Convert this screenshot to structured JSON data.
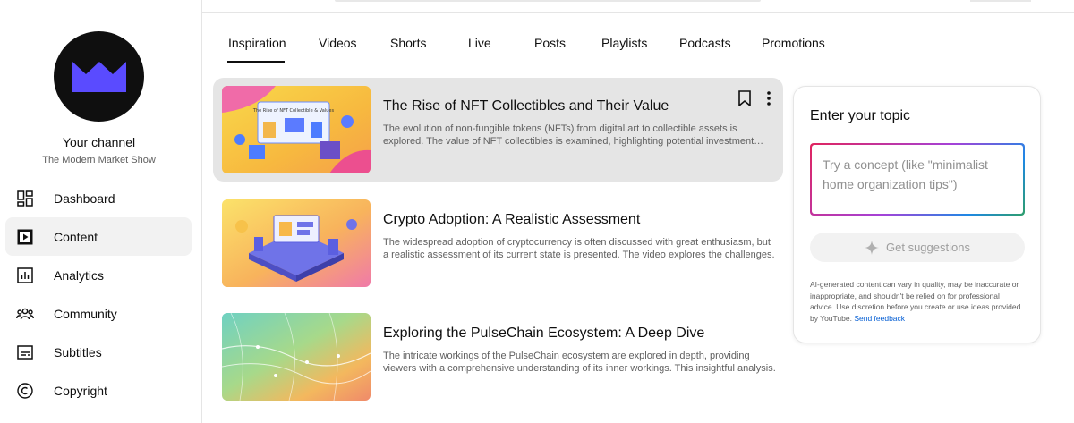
{
  "sidebar": {
    "channel_title": "Your channel",
    "channel_name": "The Modern Market Show",
    "items": [
      {
        "label": "Dashboard",
        "icon": "dashboard-icon"
      },
      {
        "label": "Content",
        "icon": "content-icon",
        "active": true
      },
      {
        "label": "Analytics",
        "icon": "analytics-icon"
      },
      {
        "label": "Community",
        "icon": "community-icon"
      },
      {
        "label": "Subtitles",
        "icon": "subtitles-icon"
      },
      {
        "label": "Copyright",
        "icon": "copyright-icon"
      }
    ]
  },
  "tabs": [
    {
      "label": "Inspiration",
      "active": true
    },
    {
      "label": "Videos"
    },
    {
      "label": "Shorts"
    },
    {
      "label": "Live"
    },
    {
      "label": "Posts"
    },
    {
      "label": "Playlists"
    },
    {
      "label": "Podcasts"
    },
    {
      "label": "Promotions"
    }
  ],
  "videos": [
    {
      "title": "The Rise of NFT Collectibles and Their Value",
      "description": "The evolution of non-fungible tokens (NFTs) from digital art to collectible assets is explored. The value of NFT collectibles is examined, highlighting potential investment opportunities.",
      "thumbnail_text": "The Rise of NFT Collectible & Values",
      "icon": "nft-thumbnail"
    },
    {
      "title": "Crypto Adoption: A Realistic Assessment",
      "description": "The widespread adoption of cryptocurrency is often discussed with great enthusiasm, but a realistic assessment of its current state is presented. The video explores the challenges.",
      "icon": "crypto-thumbnail"
    },
    {
      "title": "Exploring the PulseChain Ecosystem: A Deep Dive",
      "description": "The intricate workings of the PulseChain ecosystem are explored in depth, providing viewers with a comprehensive understanding of its inner workings. This insightful analysis.",
      "icon": "pulsechain-thumbnail"
    }
  ],
  "panel": {
    "title": "Enter your topic",
    "placeholder": "Try a concept (like \"minimalist home organization tips\")",
    "button_label": "Get suggestions",
    "disclaimer": "AI-generated content can vary in quality, may be inaccurate or inappropriate, and shouldn't be relied on for professional advice. Use discretion before you create or use ideas provided by YouTube.",
    "feedback_label": "Send feedback"
  },
  "colors": {
    "accent_purple": "#5a4bff",
    "link_blue": "#065fd4",
    "hover_bg": "#e5e5e5"
  }
}
